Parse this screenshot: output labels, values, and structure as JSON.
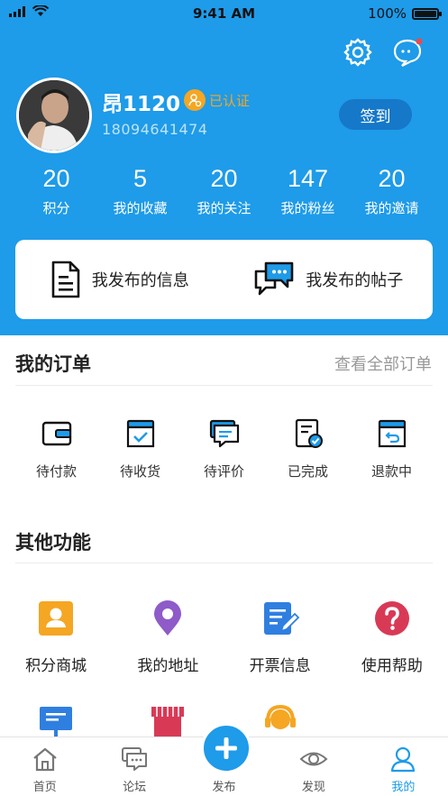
{
  "status_bar": {
    "time": "9:41 AM",
    "battery": "100%"
  },
  "profile": {
    "username": "昂1120",
    "verified_label": "已认证",
    "phone": "18094641474",
    "signin_label": "签到"
  },
  "stats": [
    {
      "value": "20",
      "label": "积分"
    },
    {
      "value": "5",
      "label": "我的收藏"
    },
    {
      "value": "20",
      "label": "我的关注"
    },
    {
      "value": "147",
      "label": "我的粉丝"
    },
    {
      "value": "20",
      "label": "我的邀请"
    }
  ],
  "publish_card": {
    "info_label": "我发布的信息",
    "posts_label": "我发布的帖子"
  },
  "orders": {
    "title": "我的订单",
    "view_all": "查看全部订单",
    "items": [
      {
        "label": "待付款",
        "icon": "wallet-icon"
      },
      {
        "label": "待收货",
        "icon": "box-check-icon"
      },
      {
        "label": "待评价",
        "icon": "comment-icon"
      },
      {
        "label": "已完成",
        "icon": "document-check-icon"
      },
      {
        "label": "退款中",
        "icon": "box-return-icon"
      }
    ]
  },
  "functions": {
    "title": "其他功能",
    "items": [
      {
        "label": "积分商城",
        "icon": "contact-card-icon"
      },
      {
        "label": "我的地址",
        "icon": "location-pin-icon"
      },
      {
        "label": "开票信息",
        "icon": "invoice-edit-icon"
      },
      {
        "label": "使用帮助",
        "icon": "help-icon"
      }
    ]
  },
  "tabbar": {
    "items": [
      {
        "label": "首页",
        "icon": "home-icon"
      },
      {
        "label": "论坛",
        "icon": "forum-icon"
      },
      {
        "label": "发布",
        "icon": "plus-icon"
      },
      {
        "label": "发现",
        "icon": "eye-icon"
      },
      {
        "label": "我的",
        "icon": "user-icon"
      }
    ],
    "active": "我的"
  },
  "colors": {
    "brand_blue": "#1E9BE9",
    "verified_orange": "#F5A623",
    "signin_bg": "#1578C8"
  }
}
